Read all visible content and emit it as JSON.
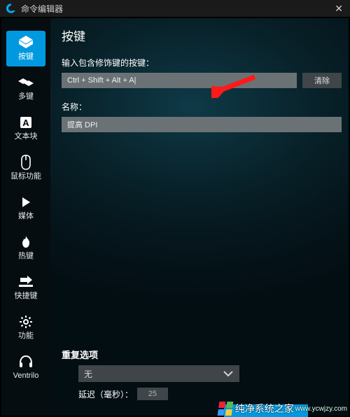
{
  "window": {
    "title": "命令编辑器",
    "close_glyph": "✕"
  },
  "sidebar": {
    "items": [
      {
        "label": "按键"
      },
      {
        "label": "多键"
      },
      {
        "label": "文本块"
      },
      {
        "label": "鼠标功能"
      },
      {
        "label": "媒体"
      },
      {
        "label": "热键"
      },
      {
        "label": "快捷键"
      },
      {
        "label": "功能"
      },
      {
        "label": "Ventrilo"
      }
    ]
  },
  "page": {
    "title": "按键",
    "key_label": "输入包含修饰键的按键：",
    "key_value": "Ctrl + Shift + Alt + A|",
    "clear_btn": "清除",
    "name_label": "名称：",
    "name_value": "提高 DPI"
  },
  "repeat": {
    "title": "重复选项",
    "mode": "无",
    "delay_label": "延迟（毫秒）：",
    "delay_value": "25"
  },
  "watermark": {
    "text": "纯净系统之家",
    "url": "www.ycwjzy.com"
  }
}
